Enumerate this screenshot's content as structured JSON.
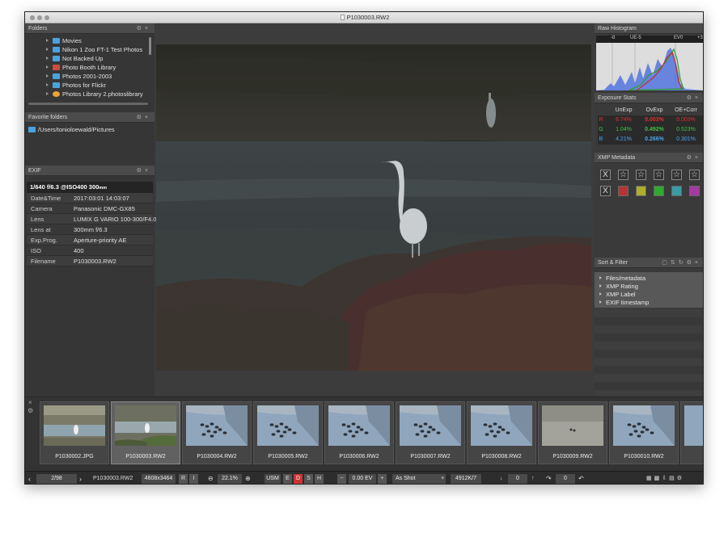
{
  "window": {
    "title": "P1030003.RW2"
  },
  "folders_panel": {
    "title": "Folders",
    "items": [
      {
        "label": "Movies",
        "icon": "folder-icon"
      },
      {
        "label": "Nikon 1 Zoo FT-1 Test Photos",
        "icon": "folder-icon"
      },
      {
        "label": "Not Backed Up",
        "icon": "folder-icon"
      },
      {
        "label": "Photo Booth Library",
        "icon": "photo-booth-icon"
      },
      {
        "label": "Photos 2001-2003",
        "icon": "folder-icon"
      },
      {
        "label": "Photos for Flickr",
        "icon": "folder-icon"
      },
      {
        "label": "Photos Library 2.photoslibrary",
        "icon": "photos-library-icon"
      }
    ]
  },
  "favorites_panel": {
    "title": "Favorite folders",
    "items": [
      "/Users/tonioloewald/Pictures"
    ]
  },
  "exif_panel": {
    "title": "EXIF",
    "summary": "1/640 f/6.3 @ISO400 300",
    "summary_unit": "mm",
    "rows": [
      {
        "key": "Date&Time",
        "value": "2017:03:01 14:03:07"
      },
      {
        "key": "Camera",
        "value": "Panasonic DMC-GX85"
      },
      {
        "key": "Lens",
        "value": "LUMIX G VARIO 100-300/F4.0"
      },
      {
        "key": "Lens at",
        "value": "300mm f/6.3"
      },
      {
        "key": "Exp.Prog.",
        "value": "Aperture-priority AE"
      },
      {
        "key": "ISO",
        "value": "400"
      },
      {
        "key": "Filename",
        "value": "P1030003.RW2"
      }
    ]
  },
  "histogram_panel": {
    "title": "Raw Histogram",
    "scale_labels": [
      "-8",
      "UE-5",
      "EV0",
      "+3"
    ]
  },
  "exposure_panel": {
    "title": "Exposure Stats",
    "headers": [
      "UnExp",
      "OvExp",
      "OE+Corr"
    ],
    "rows": [
      {
        "channel": "R",
        "values": [
          "6.74%",
          "0.003%",
          "0.003%"
        ],
        "color": "#e03030"
      },
      {
        "channel": "G",
        "values": [
          "1.04%",
          "0.492%",
          "0.523%"
        ],
        "color": "#40c040"
      },
      {
        "channel": "B",
        "values": [
          "4.21%",
          "0.266%",
          "0.301%"
        ],
        "color": "#4aa3f0"
      }
    ]
  },
  "xmp_panel": {
    "title": "XMP Metadata",
    "reject_label": "X",
    "star_glyph": "☆",
    "labels": [
      "#b83434",
      "#aeae2c",
      "#2faa2f",
      "#3a9aa5",
      "#a23aa2"
    ]
  },
  "sort_panel": {
    "title": "Sort & Filter",
    "items": [
      "Files/metadata",
      "XMP Rating",
      "XMP Label",
      "EXIF timestamp"
    ]
  },
  "filmstrip": {
    "thumbs": [
      {
        "label": "P1030002.JPG",
        "selected": false
      },
      {
        "label": "P1030003.RW2",
        "selected": true
      },
      {
        "label": "P1030004.RW2",
        "selected": false
      },
      {
        "label": "P1030005.RW2",
        "selected": false
      },
      {
        "label": "P1030006.RW2",
        "selected": false
      },
      {
        "label": "P1030007.RW2",
        "selected": false
      },
      {
        "label": "P1030008.RW2",
        "selected": false
      },
      {
        "label": "P1030009.RW2",
        "selected": false
      },
      {
        "label": "P1030010.RW2",
        "selected": false
      },
      {
        "label": "",
        "selected": false
      }
    ]
  },
  "statusbar": {
    "prev": "‹",
    "counter": "2/98",
    "next": "›",
    "filename": "P1030003.RW2",
    "dimensions": "4608x3464",
    "btn_r": "R",
    "btn_i": "I",
    "zoom_out": "⊖",
    "zoom": "22.1%",
    "zoom_in": "⊕",
    "usm": "USM",
    "btn_e": "E",
    "btn_d": "D",
    "btn_s": "S",
    "btn_h": "H",
    "ev_minus": "−",
    "ev": "0.00 EV",
    "ev_plus": "+",
    "wb": "As Shot",
    "temp": "4912K/7",
    "down_arrow": "↓",
    "tint": "0",
    "up_arrow": "↑",
    "rot": "0",
    "redo": "↷",
    "undo": "↶"
  }
}
